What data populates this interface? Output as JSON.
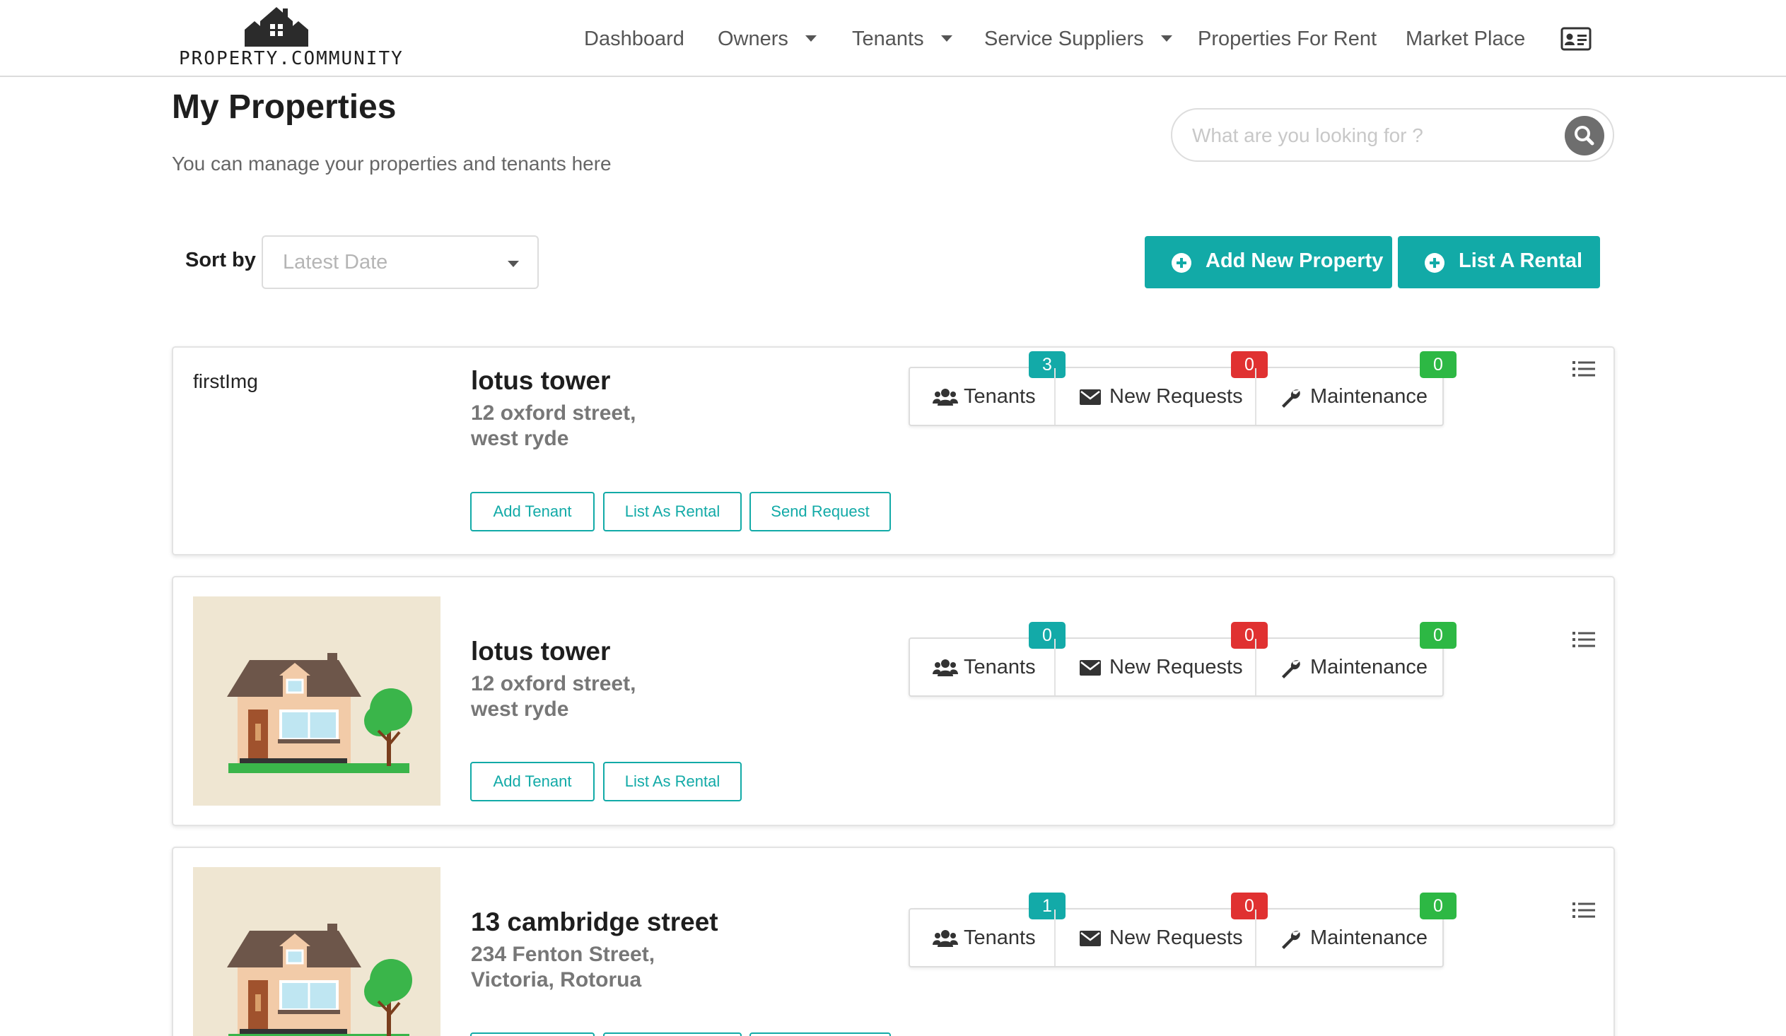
{
  "header": {
    "logo_text": "PROPERTY.COMMUNITY",
    "nav": [
      {
        "label": "Dashboard"
      },
      {
        "label": "Owners"
      },
      {
        "label": "Tenants"
      },
      {
        "label": "Service Suppliers"
      },
      {
        "label": "Properties For Rent"
      },
      {
        "label": "Market Place"
      }
    ]
  },
  "page": {
    "title": "My Properties",
    "subtitle": "You can manage your properties and tenants here"
  },
  "search": {
    "placeholder": "What are you looking for ?"
  },
  "sort": {
    "label": "Sort by :",
    "value": "Latest Date"
  },
  "actions": {
    "add_property": "Add New Property",
    "list_rental": "List A Rental"
  },
  "stat_labels": {
    "tenants": "Tenants",
    "requests": "New Requests",
    "maintenance": "Maintenance"
  },
  "properties": [
    {
      "image_alt": "firstImg",
      "name": "lotus tower",
      "address_line1": "12 oxford street,",
      "address_line2": "west ryde",
      "tenants": "3",
      "requests": "0",
      "maintenance": "0",
      "buttons": [
        "Add Tenant",
        "List As Rental",
        "Send Request"
      ]
    },
    {
      "name": "lotus tower",
      "address_line1": "12 oxford street,",
      "address_line2": "west ryde",
      "tenants": "0",
      "requests": "0",
      "maintenance": "0",
      "buttons": [
        "Add Tenant",
        "List As Rental"
      ]
    },
    {
      "name": "13 cambridge street",
      "address_line1": "234 Fenton Street,",
      "address_line2": "Victoria, Rotorua",
      "tenants": "1",
      "requests": "0",
      "maintenance": "0"
    }
  ],
  "colors": {
    "accent": "#12aaa7",
    "badge_red": "#e03131",
    "badge_green": "#2db844"
  }
}
